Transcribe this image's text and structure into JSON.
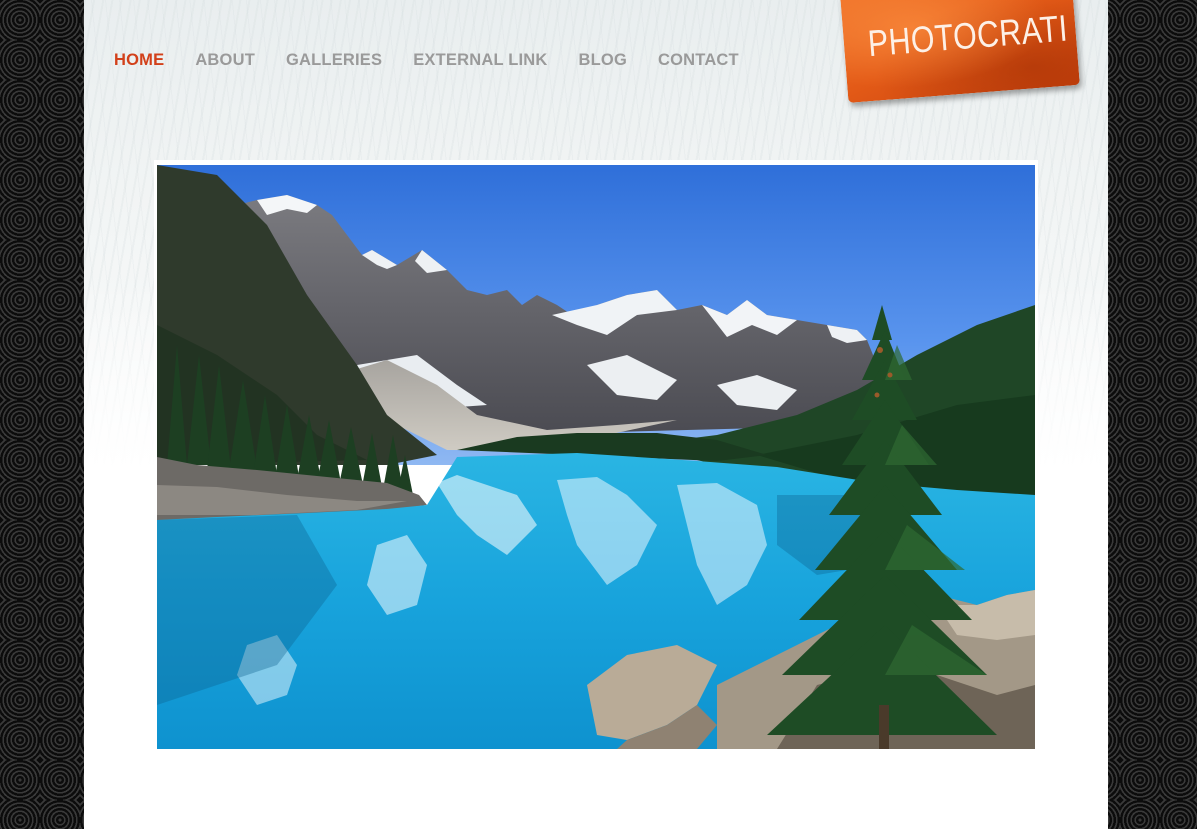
{
  "nav": {
    "items": [
      {
        "label": "HOME",
        "active": true
      },
      {
        "label": "ABOUT",
        "active": false
      },
      {
        "label": "GALLERIES",
        "active": false
      },
      {
        "label": "EXTERNAL LINK",
        "active": false
      },
      {
        "label": "BLOG",
        "active": false
      },
      {
        "label": "CONTACT",
        "active": false
      }
    ]
  },
  "logo": {
    "text": "PHOTOCRATI",
    "color": "#e35a17"
  },
  "colors": {
    "nav_active": "#d2401a",
    "nav_inactive": "#9a9a9a",
    "page_background": "#0c0c0c"
  },
  "hero": {
    "image": "mountain-lake-landscape"
  }
}
